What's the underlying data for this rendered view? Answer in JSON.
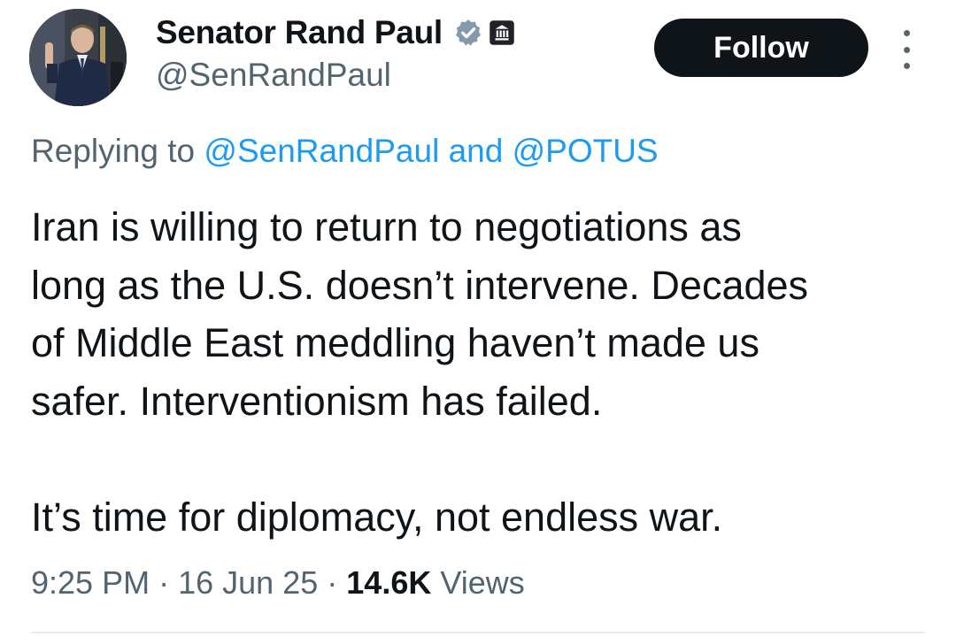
{
  "author": {
    "display_name": "Senator Rand Paul",
    "handle": "@SenRandPaul",
    "verified_badge_icon": "verified-check-icon",
    "government_badge_icon": "government-building-icon",
    "verified_badge_color": "#829aab"
  },
  "actions": {
    "follow_label": "Follow",
    "more_icon": "more-vertical-icon"
  },
  "reply": {
    "prefix": "Replying to",
    "mention_1": "@SenRandPaul",
    "joiner": "and",
    "mention_2": "@POTUS"
  },
  "tweet": {
    "text": "Iran is willing to return to negotiations as\nlong as the U.S. doesn’t intervene. Decades\nof Middle East meddling haven’t made us\nsafer. Interventionism has failed.\n\nIt’s time for diplomacy, not endless war."
  },
  "meta": {
    "time": "9:25 PM",
    "separator": "·",
    "date": "16 Jun 25",
    "views_count": "14.6K",
    "views_label": "Views"
  },
  "colors": {
    "link": "#1d9bf0",
    "secondary_text": "#536471",
    "primary_text": "#0f1419",
    "follow_bg": "#0f1419"
  }
}
